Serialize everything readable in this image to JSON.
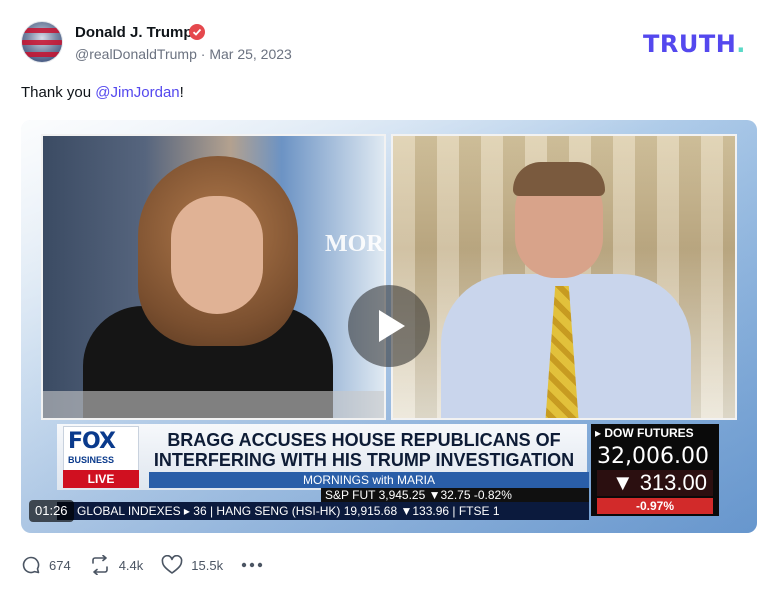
{
  "author": {
    "name": "Donald J. Trump",
    "handle": "@realDonaldTrump",
    "date": "Mar 25, 2023"
  },
  "brand": {
    "text": "TRUTH",
    "dot": "."
  },
  "post": {
    "text_prefix": "Thank you ",
    "mention": "@JimJordan",
    "text_suffix": "!"
  },
  "video": {
    "timestamp": "01:26",
    "studio_logo": "MORN",
    "lower_third": {
      "network": "FOX",
      "network_sub": "BUSINESS",
      "live": "LIVE",
      "headline_line1": "BRAGG ACCUSES HOUSE REPUBLICANS OF",
      "headline_line2": "INTERFERING WITH HIS TRUMP INVESTIGATION",
      "show": "MORNINGS with MARIA",
      "ticker_top": "S&P FUT  3,945.25 ▼32.75 -0.82%",
      "ticker_bottom": "GLOBAL INDEXES ▸ 36 | HANG SENG (HSI-HK) 19,915.68 ▼133.96 | FTSE 1"
    },
    "futures": {
      "label": "▸ DOW FUTURES",
      "value": "32,006.00",
      "change": "▼ 313.00",
      "pct": "-0.97%"
    }
  },
  "actions": {
    "replies": "674",
    "retruths": "4.4k",
    "likes": "15.5k"
  },
  "colors": {
    "brand": "#5448ee",
    "brand_dot": "#5bd9c7",
    "verified": "#e5484d",
    "mention": "#5448ee",
    "meta": "#6b7280"
  }
}
